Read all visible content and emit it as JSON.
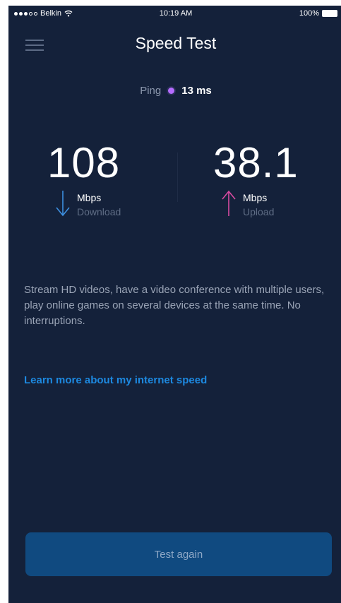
{
  "status_bar": {
    "carrier": "Belkin",
    "time": "10:19 AM",
    "battery": "100%",
    "icons": [
      "signal-dots-icon",
      "wifi-icon",
      "battery-icon"
    ]
  },
  "header": {
    "title": "Speed Test",
    "menu_icon": "hamburger-menu-icon"
  },
  "ping": {
    "label": "Ping",
    "value": "13 ms",
    "indicator_color": "#b56cff"
  },
  "download": {
    "value": "108",
    "unit": "Mbps",
    "label": "Download",
    "icon": "arrow-down-icon",
    "color": "#3d8fe0"
  },
  "upload": {
    "value": "38.1",
    "unit": "Mbps",
    "label": "Upload",
    "icon": "arrow-up-icon",
    "color": "#d64aa0"
  },
  "description": "Stream HD videos, have a video conference with multiple users, play online games on several devices at the same time. No interruptions.",
  "learn_more": "Learn more about my internet speed",
  "test_button": "Test again",
  "colors": {
    "background": "#14213a",
    "accent": "#1d89e0",
    "button": "#104a80"
  }
}
